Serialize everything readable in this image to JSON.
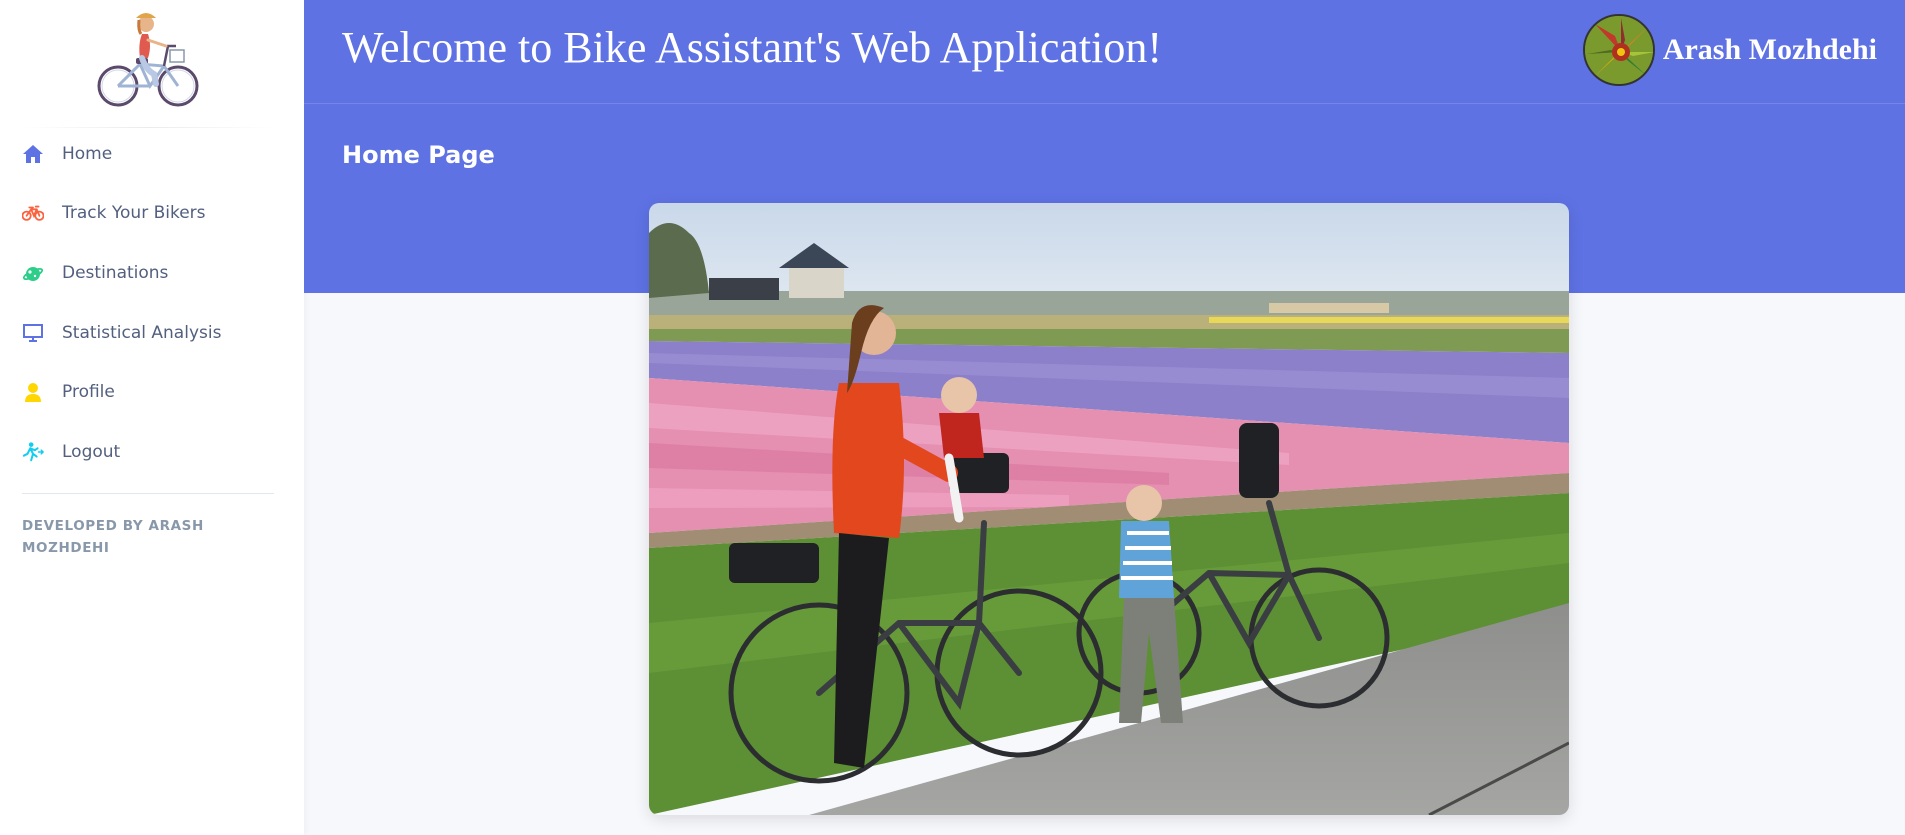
{
  "app": {
    "welcome": "Welcome to Bike Assistant's Web Application!",
    "user_name": "Arash Mozhdehi"
  },
  "sidebar": {
    "items": [
      {
        "label": "Home",
        "icon": "home-icon",
        "color": "#5e72e4"
      },
      {
        "label": "Track Your Bikers",
        "icon": "bike-icon",
        "color": "#fb6340"
      },
      {
        "label": "Destinations",
        "icon": "planet-icon",
        "color": "#2dce89"
      },
      {
        "label": "Statistical Analysis",
        "icon": "monitor-icon",
        "color": "#5e72e4"
      },
      {
        "label": "Profile",
        "icon": "user-icon",
        "color": "#ffd600"
      },
      {
        "label": "Logout",
        "icon": "running-icon",
        "color": "#11cdef"
      }
    ],
    "credit": "DEVELOPED BY ARASH MOZHDEHI"
  },
  "main": {
    "page_title": "Home Page"
  },
  "colors": {
    "primary": "#5e72e4",
    "background": "#f7f8fc",
    "nav_text": "#525f7f",
    "muted": "#8898aa"
  }
}
